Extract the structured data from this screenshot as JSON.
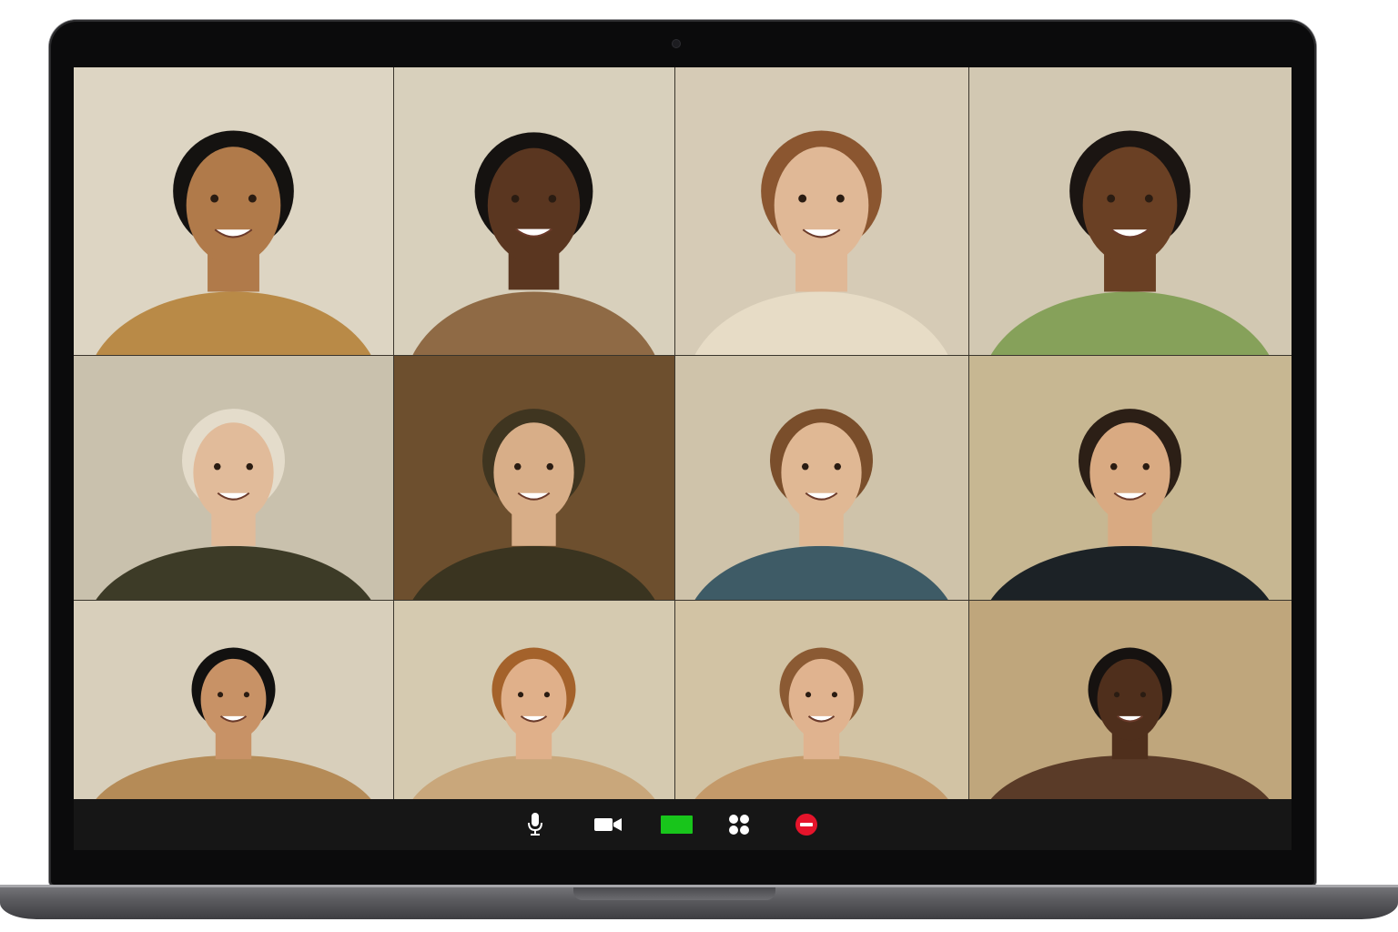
{
  "meeting": {
    "participants": [
      {
        "tile": "r1c1",
        "bg": "#ddd5c3",
        "skin": "#b07a4a",
        "hair": "#141210",
        "shirt": "#b98a47"
      },
      {
        "tile": "r1c2",
        "bg": "#d8d0bc",
        "skin": "#5a3620",
        "hair": "#151210",
        "shirt": "#8f6a45"
      },
      {
        "tile": "r1c3",
        "bg": "#d6cbb6",
        "skin": "#e0b896",
        "hair": "#8b5630",
        "shirt": "#e7dcc6"
      },
      {
        "tile": "r1c4",
        "bg": "#d2c8b2",
        "skin": "#6a4024",
        "hair": "#1b1512",
        "shirt": "#86a15a"
      },
      {
        "tile": "r2c1",
        "bg": "#c9c1ad",
        "skin": "#e1bb9a",
        "hair": "#e4dccb",
        "shirt": "#3d3b27"
      },
      {
        "tile": "r2c2",
        "bg": "#6d4f2e",
        "skin": "#d8ae88",
        "hair": "#3f3520",
        "shirt": "#3a3420"
      },
      {
        "tile": "r2c3",
        "bg": "#cfc3aa",
        "skin": "#e0b894",
        "hair": "#7a4e2b",
        "shirt": "#3e5b66"
      },
      {
        "tile": "r2c4",
        "bg": "#c7b792",
        "skin": "#d9aa82",
        "hair": "#2c1f16",
        "shirt": "#1c2226"
      },
      {
        "tile": "r3c1",
        "bg": "#d8cfbb",
        "skin": "#c89266",
        "hair": "#121110",
        "shirt": "#b58b57"
      },
      {
        "tile": "r3c2",
        "bg": "#d5cab0",
        "skin": "#e0b08a",
        "hair": "#a4622b",
        "shirt": "#c9a77b"
      },
      {
        "tile": "r3c3",
        "bg": "#d2c3a4",
        "skin": "#e0b38f",
        "hair": "#8b5a33",
        "shirt": "#c49a6a"
      },
      {
        "tile": "r3c4",
        "bg": "#bfa67c",
        "skin": "#4f2f1c",
        "hair": "#161210",
        "shirt": "#5a3b28"
      }
    ]
  },
  "controls": {
    "mic_icon": "microphone-icon",
    "video_icon": "video-camera-icon",
    "share_icon": "share-screen-icon",
    "share_color": "#18c51b",
    "grid_icon": "grid-view-icon",
    "leave_icon": "end-call-icon",
    "leave_color": "#e5142b"
  }
}
